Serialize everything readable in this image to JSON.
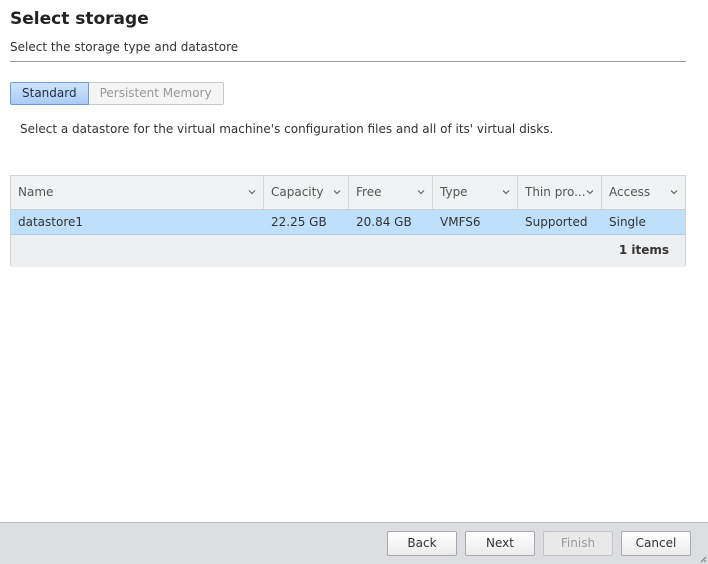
{
  "header": {
    "title": "Select storage",
    "subtitle": "Select the storage type and datastore"
  },
  "tabs": [
    {
      "label": "Standard",
      "selected": true
    },
    {
      "label": "Persistent Memory",
      "selected": false
    }
  ],
  "instruction": "Select a datastore for the virtual machine's configuration files and all of its' virtual disks.",
  "grid": {
    "columns": [
      "Name",
      "Capacity",
      "Free",
      "Type",
      "Thin pro...",
      "Access"
    ],
    "rows": [
      {
        "name": "datastore1",
        "capacity": "22.25 GB",
        "free": "20.84 GB",
        "type": "VMFS6",
        "thin": "Supported",
        "access": "Single",
        "selected": true
      }
    ],
    "item_count": "1 items"
  },
  "footer": {
    "back": "Back",
    "next": "Next",
    "finish": "Finish",
    "cancel": "Cancel"
  },
  "colors": {
    "selected_row": "#bfe0fb",
    "active_tab": "#a9ccf5",
    "footer_bar": "#dcdee1"
  },
  "icons": [
    "chevron-down-icon",
    "resize-grip-icon"
  ]
}
